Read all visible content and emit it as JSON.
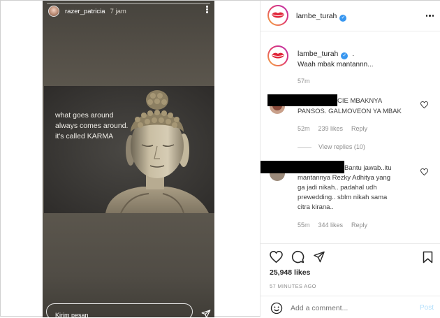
{
  "story": {
    "username": "razer_patricia",
    "time": "7 jam",
    "quote": "what goes around always comes around. it's called KARMA",
    "reply_placeholder": "Kirim pesan"
  },
  "post": {
    "header_username": "lambe_turah",
    "caption_username": "lambe_turah",
    "caption_dot": ".",
    "caption_text": "Waah mbak mantannn...",
    "caption_time": "57m",
    "comments": [
      {
        "lines": [
          "CIE MBAKNYA",
          "PANSOS. GALMOVEON YA MBAK"
        ],
        "time": "52m",
        "likes": "239 likes",
        "reply": "Reply",
        "view_replies": "View replies (10)"
      },
      {
        "lines": [
          "Bantu jawab..itu",
          "mantannya Rezky Adhitya yang",
          "ga jadi nikah.. padahal udh",
          "prewedding.. sblm nikah sama",
          "citra kirana.."
        ],
        "time": "55m",
        "likes": "344 likes",
        "reply": "Reply"
      }
    ],
    "likes_count": "25,948 likes",
    "time_ago": "57 MINUTES AGO",
    "add_comment_placeholder": "Add a comment...",
    "post_button": "Post"
  },
  "colors": {
    "verified": "#3897f0",
    "post_button": "#b2dffc",
    "muted_text": "#8e8e8e",
    "lips": "#e0263a"
  },
  "icons": [
    "more-icon",
    "verified-badge-icon",
    "heart-icon",
    "comment-icon",
    "share-icon",
    "bookmark-icon",
    "emoji-icon",
    "send-icon"
  ]
}
